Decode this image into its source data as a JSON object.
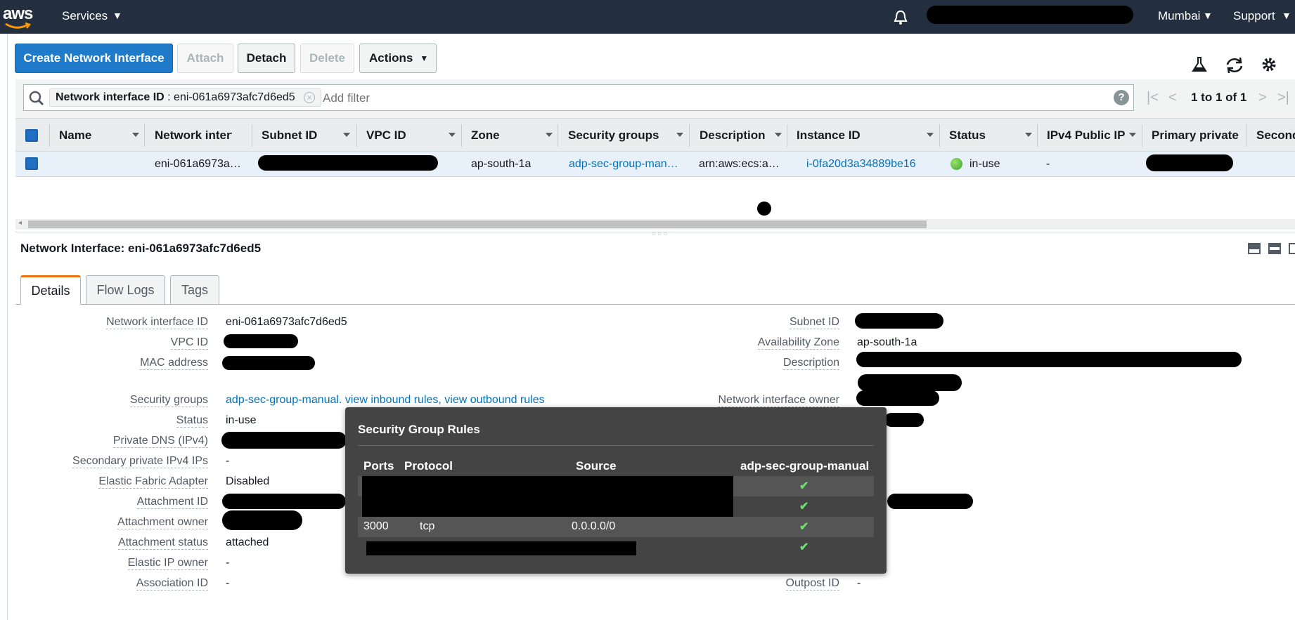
{
  "topbar": {
    "logo": "aws",
    "services": "Services",
    "region": "Mumbai",
    "support": "Support"
  },
  "toolbar": {
    "create": "Create Network Interface",
    "attach": "Attach",
    "detach": "Detach",
    "delete": "Delete",
    "actions": "Actions"
  },
  "filter": {
    "chip_key": "Network interface ID",
    "chip_value": " : eni-061a6973afc7d6ed5",
    "placeholder": "Add filter",
    "pagination": "1 to 1 of 1"
  },
  "table": {
    "columns": [
      "Name",
      "Network interfâ",
      "Subnet ID",
      "VPC ID",
      "Zone",
      "Security groups",
      "Description",
      "Instance ID",
      "Status",
      "IPv4 Public IP",
      "Primary private",
      "Second"
    ],
    "row": {
      "name": "",
      "eni": "eni-061a6973a…",
      "zone": "ap-south-1a",
      "security_groups": "adp-sec-group-man…",
      "description": "arn:aws:ecs:a…",
      "instance_id": "i-0fa20d3a34889be16",
      "status": "in-use",
      "ipv4_public": "-"
    }
  },
  "detail": {
    "title": "Network Interface: eni-061a6973afc7d6ed5",
    "tabs": [
      "Details",
      "Flow Logs",
      "Tags"
    ],
    "left": [
      {
        "label": "Network interface ID",
        "value": "eni-061a6973afc7d6ed5"
      },
      {
        "label": "VPC ID",
        "value": ""
      },
      {
        "label": "MAC address",
        "value": ""
      },
      {
        "label": "Security groups",
        "value": ""
      },
      {
        "label": "Status",
        "value": "in-use"
      },
      {
        "label": "Private DNS (IPv4)",
        "value": ""
      },
      {
        "label": "Secondary private IPv4 IPs",
        "value": "-"
      },
      {
        "label": "Elastic Fabric Adapter",
        "value": "Disabled"
      },
      {
        "label": "Attachment ID",
        "value": ""
      },
      {
        "label": "Attachment owner",
        "value": ""
      },
      {
        "label": "Attachment status",
        "value": "attached"
      },
      {
        "label": "Elastic IP owner",
        "value": "-"
      },
      {
        "label": "Association ID",
        "value": "-"
      }
    ],
    "sg_links": {
      "group": "adp-sec-group-manual.",
      "inbound": "view inbound rules,",
      "outbound": "view outbound rules"
    },
    "right": [
      {
        "label": "Subnet ID",
        "value": ""
      },
      {
        "label": "Availability Zone",
        "value": "ap-south-1a"
      },
      {
        "label": "Description",
        "value": ""
      },
      {
        "label": "Network interface owner",
        "value": ""
      },
      {
        "label": "Outpost ID",
        "value": "-"
      }
    ]
  },
  "popup": {
    "title": "Security Group Rules",
    "headers": {
      "ports": "Ports",
      "protocol": "Protocol",
      "source": "Source",
      "group": "adp-sec-group-manual"
    },
    "rows": [
      {
        "ports": "",
        "protocol": "",
        "source": "",
        "check": "✔"
      },
      {
        "ports": "",
        "protocol": "",
        "source": "",
        "check": "✔"
      },
      {
        "ports": "3000",
        "protocol": "tcp",
        "source": "0.0.0.0/0",
        "check": "✔"
      },
      {
        "ports": "",
        "protocol": "",
        "source": "",
        "check": "✔"
      }
    ]
  }
}
